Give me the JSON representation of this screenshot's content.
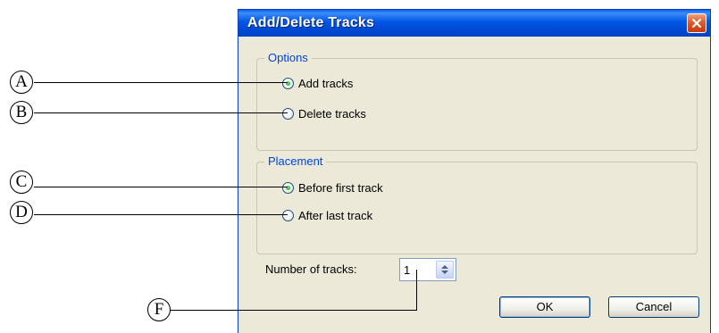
{
  "dialog": {
    "title": "Add/Delete Tracks",
    "close_icon": "close-icon"
  },
  "options_group": {
    "legend": "Options",
    "items": [
      {
        "label": "Add tracks",
        "selected": true
      },
      {
        "label": "Delete tracks",
        "selected": false
      }
    ]
  },
  "placement_group": {
    "legend": "Placement",
    "items": [
      {
        "label": "Before first track",
        "selected": true
      },
      {
        "label": "After last track",
        "selected": false
      }
    ]
  },
  "number_of_tracks": {
    "label": "Number of tracks:",
    "value": "1"
  },
  "buttons": {
    "ok": "OK",
    "cancel": "Cancel"
  },
  "callouts": [
    "A",
    "B",
    "C",
    "D",
    "F"
  ],
  "colors": {
    "titlebar": "#0054e3",
    "dialog_bg": "#ece9d8",
    "legend_text": "#0046d5",
    "close_button": "#e05a2a"
  }
}
